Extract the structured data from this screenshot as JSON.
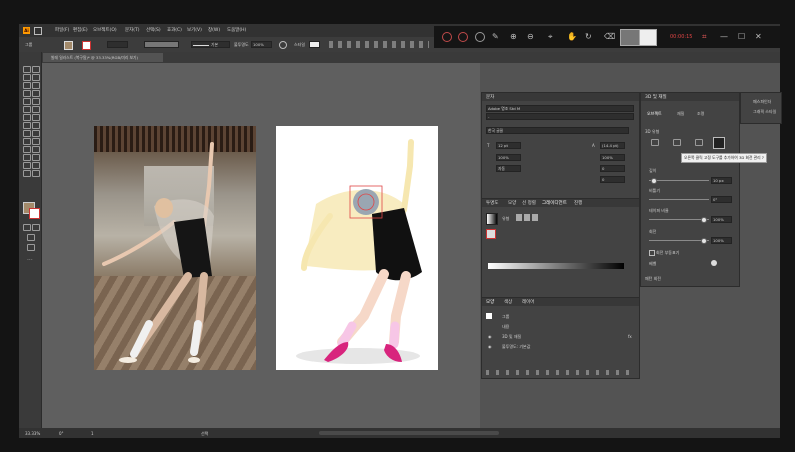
{
  "app": {
    "title": "Adobe Illustrator"
  },
  "menu": {
    "items": [
      "파일(F)",
      "편집(E)",
      "오브젝트(O)",
      "문자(T)",
      "선택(S)",
      "효과(C)",
      "보기(V)",
      "창(W)",
      "도움말(H)"
    ]
  },
  "control_bar": {
    "selection_label": "그룹",
    "stroke_style": "기본",
    "opacity_label": "불투명도",
    "opacity_value": "100%",
    "style_label": "스타일"
  },
  "document_tab": {
    "label": "발레 일러스트 (복구됨)* @ 33.33%(RGB/미리 보기)"
  },
  "recorder": {
    "timer": "00:00:15"
  },
  "character_panel": {
    "title": "문자",
    "font_name": "Adobe 명조 Std M",
    "font_style": "-",
    "korean_font": "한국 글꼴",
    "size_value": "12 pt",
    "leading_value": "(14.4 pt)",
    "scale_v": "100%",
    "scale_h": "100%",
    "kern": "자동",
    "track": "0",
    "rotate": "0"
  },
  "gradient_panel": {
    "tabs": [
      "투명도",
      "모양",
      "선 정렬",
      "그레이디언트",
      "진행"
    ],
    "active_tab": "그레이디언트",
    "type_label": "유형"
  },
  "layers_panel": {
    "tabs": [
      "모양",
      "색상",
      "레이어"
    ],
    "rows": [
      {
        "label": "그룹"
      },
      {
        "label": "내용"
      },
      {
        "label": "3D 및 재질"
      },
      {
        "label": "불투명도: 기본값"
      }
    ],
    "fx_label": "fx"
  },
  "threed_panel": {
    "title": "3D 및 재질",
    "tabs": [
      "오브젝트",
      "재질",
      "조명"
    ],
    "section": "3D 유형",
    "tooltip": "오른쪽 클릭 고정 도구를 추가하여 3D 회전 관리 ?",
    "depth_label": "깊이",
    "depth_value": "10 px",
    "bevel_label": "비틀기",
    "bevel_value": "0°",
    "taper_label": "테이퍼 비율",
    "taper_value": "100%",
    "rotate_label": "회전",
    "rotate_value": "100%",
    "checkbox_label": "회전 부동표기",
    "bevel2_label": "베벨",
    "footer": "패턴 회전"
  },
  "side_dock": {
    "items": [
      "패스파인더",
      "그래픽 스타일"
    ]
  },
  "status_bar": {
    "zoom": "33.33%",
    "rotation": "0°",
    "page": "1",
    "mode": "선택"
  },
  "colors": {
    "accent": "#2680eb",
    "recorder_red": "#c04a4a",
    "tutu": "#f6e7b0",
    "shoes": "#d8247d",
    "leg": "#f6d8c8"
  }
}
